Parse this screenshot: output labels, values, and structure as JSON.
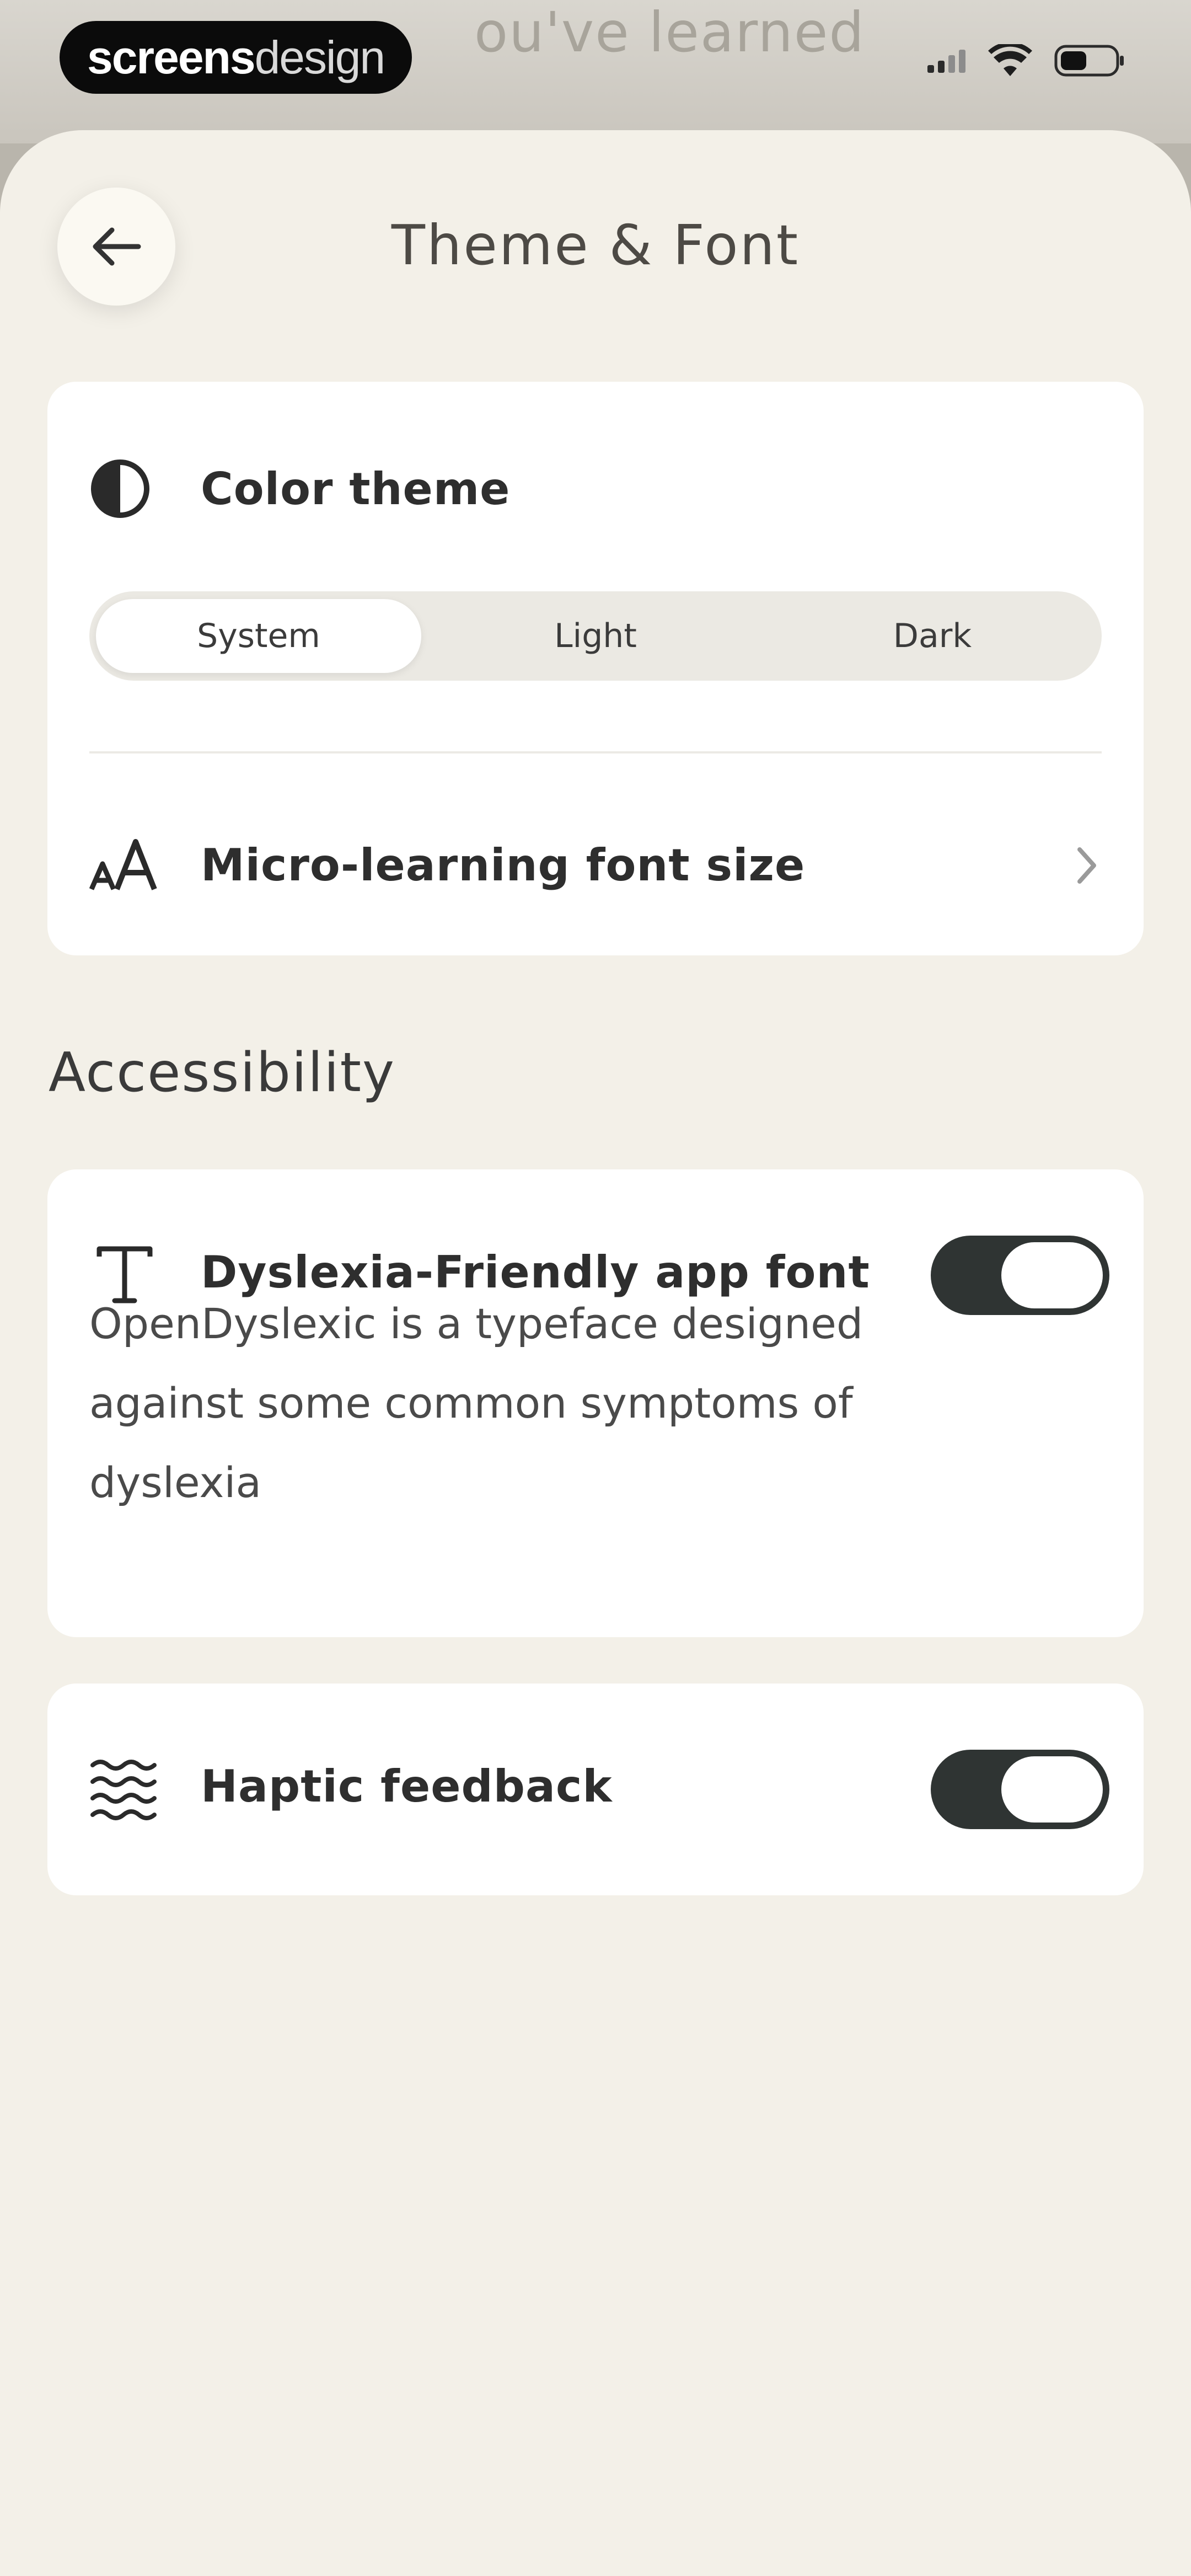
{
  "status_bar": {
    "watermark_bold": "screens",
    "watermark_light": "design",
    "background_peek_text": "ou've learned",
    "icons": [
      "cellular-signal-icon",
      "wifi-icon",
      "battery-icon"
    ]
  },
  "header": {
    "title": "Theme & Font",
    "back_icon": "arrow-left-icon"
  },
  "theme_card": {
    "color_theme_label": "Color theme",
    "color_theme_icon": "contrast-icon",
    "segments": [
      {
        "label": "System",
        "selected": true
      },
      {
        "label": "Light",
        "selected": false
      },
      {
        "label": "Dark",
        "selected": false
      }
    ],
    "font_size_label": "Micro-learning font size",
    "font_size_icon": "font-size-icon",
    "chevron_icon": "chevron-right-icon"
  },
  "accessibility": {
    "heading": "Accessibility",
    "dyslexia": {
      "label": "Dyslexia-Friendly app font",
      "icon": "typeface-icon",
      "description": "OpenDyslexic is a typeface designed against some common symptoms of dyslexia",
      "enabled": true
    },
    "haptic": {
      "label": "Haptic feedback",
      "icon": "waves-icon",
      "enabled": true
    }
  },
  "colors": {
    "sheet_background": "#f3f0e8",
    "card_background": "#ffffff",
    "toggle_on": "#2f3433",
    "text_primary": "#2e2e2e"
  }
}
